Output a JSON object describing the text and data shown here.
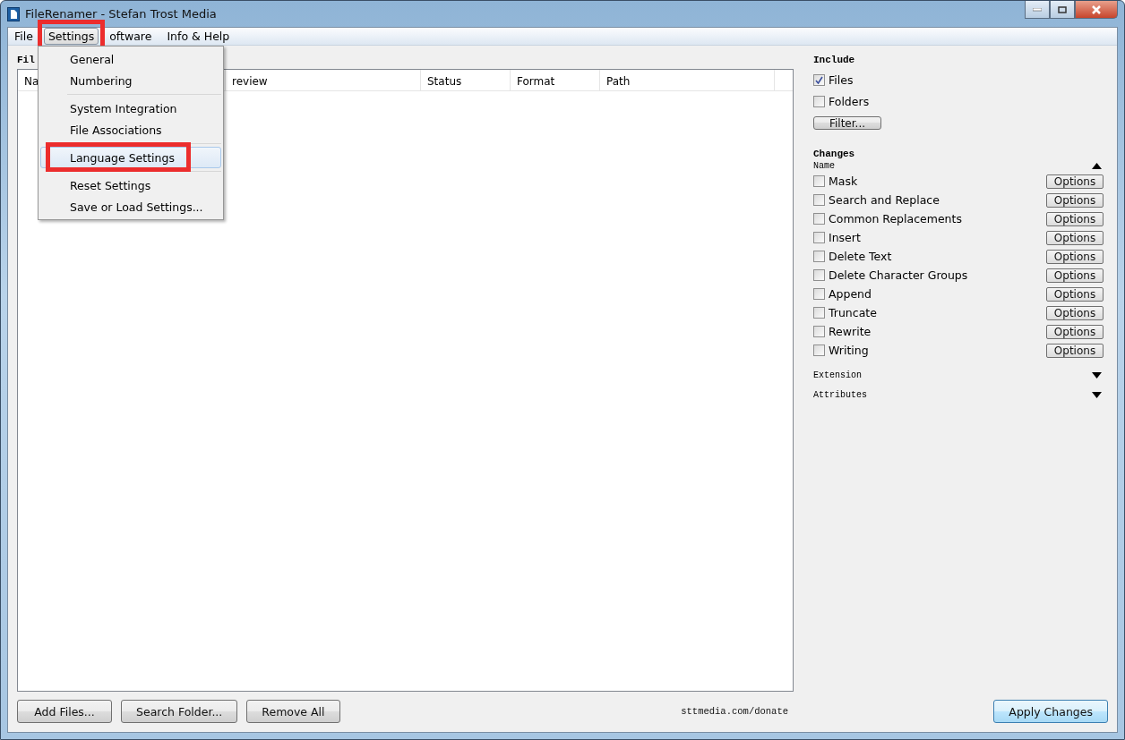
{
  "window": {
    "title": "FileRenamer - Stefan Trost Media"
  },
  "menu_bar": [
    {
      "label": "File",
      "selected": false,
      "highlighted": false
    },
    {
      "label": "Settings",
      "selected": true,
      "highlighted": true
    },
    {
      "label": "oftware",
      "selected": false,
      "highlighted": false
    },
    {
      "label": "Info & Help",
      "selected": false,
      "highlighted": false
    }
  ],
  "settings_menu": {
    "groups": [
      [
        {
          "label": "General",
          "selected": false,
          "highlighted": false
        },
        {
          "label": "Numbering",
          "selected": false,
          "highlighted": false
        }
      ],
      [
        {
          "label": "System Integration",
          "selected": false,
          "highlighted": false
        },
        {
          "label": "File Associations",
          "selected": false,
          "highlighted": false
        }
      ],
      [
        {
          "label": "Language Settings",
          "selected": true,
          "highlighted": true
        }
      ],
      [
        {
          "label": "Reset Settings",
          "selected": false,
          "highlighted": false
        },
        {
          "label": "Save or Load Settings...",
          "selected": false,
          "highlighted": false
        }
      ]
    ]
  },
  "files_panel": {
    "title": "Fil",
    "columns": [
      "Na",
      "review",
      "Status",
      "Format",
      "Path"
    ]
  },
  "buttons": [
    "Add Files...",
    "Search Folder...",
    "Remove All"
  ],
  "donate_link": "sttmedia.com/donate",
  "include": {
    "title": "Include",
    "options": [
      {
        "label": "Files",
        "checked": true
      },
      {
        "label": "Folders",
        "checked": false
      }
    ],
    "filter_button": "Filter..."
  },
  "changes": {
    "title": "Changes",
    "sections": [
      {
        "label": "Name",
        "expanded": true,
        "items": [
          {
            "label": "Mask",
            "checked": false,
            "button": "Options"
          },
          {
            "label": "Search and Replace",
            "checked": false,
            "button": "Options"
          },
          {
            "label": "Common Replacements",
            "checked": false,
            "button": "Options"
          },
          {
            "label": "Insert",
            "checked": false,
            "button": "Options"
          },
          {
            "label": "Delete Text",
            "checked": false,
            "button": "Options"
          },
          {
            "label": "Delete Character Groups",
            "checked": false,
            "button": "Options"
          },
          {
            "label": "Append",
            "checked": false,
            "button": "Options"
          },
          {
            "label": "Truncate",
            "checked": false,
            "button": "Options"
          },
          {
            "label": "Rewrite",
            "checked": false,
            "button": "Options"
          },
          {
            "label": "Writing",
            "checked": false,
            "button": "Options"
          }
        ]
      },
      {
        "label": "Extension",
        "expanded": false
      },
      {
        "label": "Attributes",
        "expanded": false
      }
    ]
  },
  "apply_button": "Apply Changes"
}
